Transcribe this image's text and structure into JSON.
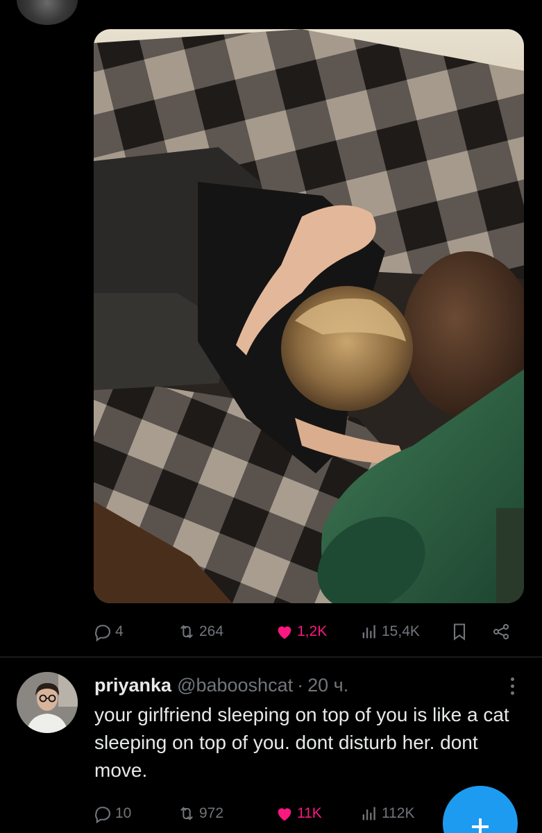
{
  "tweet": {
    "media": {
      "alt": "photo"
    },
    "stats": {
      "replies": "4",
      "reposts": "264",
      "likes": "1,2K",
      "views": "15,4K"
    },
    "icons": {
      "reply": "reply-icon",
      "repost": "repost-icon",
      "like": "heart-icon",
      "views": "views-icon",
      "bookmark": "bookmark-icon",
      "share": "share-icon"
    }
  },
  "reply_tweet": {
    "name": "priyanka",
    "handle": "@babooshcat",
    "separator": "·",
    "time": "20 ч.",
    "text": "your girlfriend sleeping on top of you is like a cat sleeping on top of you. dont disturb her. dont move.",
    "stats": {
      "replies": "10",
      "reposts": "972",
      "likes": "11K",
      "views": "112K"
    }
  },
  "fab": {
    "label": "+"
  },
  "colors": {
    "background": "#000000",
    "text": "#e7e9ea",
    "muted": "#71767b",
    "like": "#f91880",
    "accent": "#1d9bf0",
    "divider": "#2f3336"
  }
}
